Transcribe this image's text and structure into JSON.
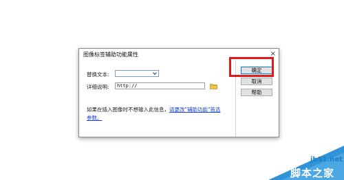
{
  "dialog": {
    "title": "图像标签辅助功能属性",
    "close_glyph": "×",
    "alt_text_label": "替换文本:",
    "alt_text_value": "",
    "desc_label": "详细说明:",
    "desc_value": "http://",
    "note_text": "如果在插入图像时不想输入此信息，",
    "note_link": "请更改\"辅助功能\"首选参数。",
    "buttons": {
      "ok": "确定",
      "cancel": "取消",
      "help": "帮助"
    }
  },
  "watermark": {
    "url": "jb51.net",
    "brand": "脚本之家"
  },
  "colors": {
    "highlight": "#e0191b",
    "link": "#1a3fd6",
    "watermark_blue": "#1b7fc6"
  }
}
